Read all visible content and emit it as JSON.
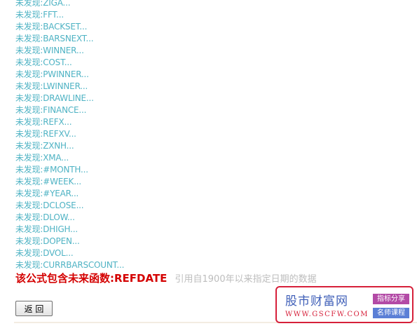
{
  "results": [
    "未发现:ZIGA...",
    "未发现:FFT...",
    "未发现:BACKSET...",
    "未发现:BARSNEXT...",
    "未发现:WINNER...",
    "未发现:COST...",
    "未发现:PWINNER...",
    "未发现:LWINNER...",
    "未发现:DRAWLINE...",
    "未发现:FINANCE...",
    "未发现:REFX...",
    "未发现:REFXV...",
    "未发现:ZXNH...",
    "未发现:XMA...",
    "未发现:#MONTH...",
    "未发现:#WEEK...",
    "未发现:#YEAR...",
    "未发现:DCLOSE...",
    "未发现:DLOW...",
    "未发现:DHIGH...",
    "未发现:DOPEN...",
    "未发现:DVOL...",
    "未发现:CURRBARSCOUNT..."
  ],
  "warning": {
    "label": "该公式包含未来函数:REFDATE",
    "description": "引用自1900年以来指定日期的数据"
  },
  "back_button": {
    "label": "返 回"
  },
  "watermark": {
    "name": "股市财富网",
    "url": "WWW.GSCFW.COM",
    "tag1": "指标分享",
    "tag2": "名师课程"
  },
  "colors": {
    "result_text": "#4fb3c4",
    "warning_text": "#d40000",
    "description_text": "#bdbdbd",
    "watermark_border": "#d6203a",
    "watermark_name": "#3f5fb8",
    "watermark_tag1": "#b34aa6",
    "watermark_tag2": "#5b7fd6"
  }
}
